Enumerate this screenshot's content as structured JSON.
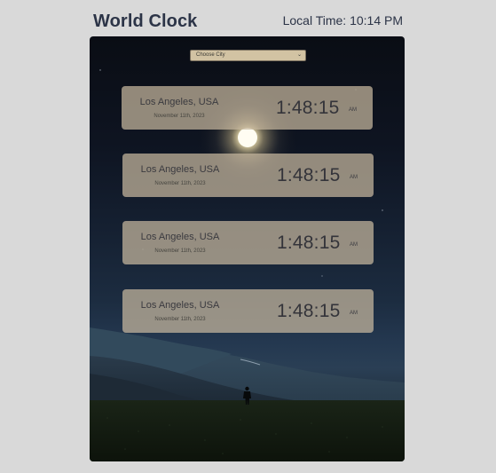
{
  "header": {
    "title": "World Clock",
    "local_time": "Local Time: 10:14 PM"
  },
  "city_select": {
    "selected_label": "Choose City"
  },
  "clocks": [
    {
      "city": "Los Angeles, USA",
      "date": "November 11th, 2023",
      "time": "1:48:15",
      "ampm": "AM"
    },
    {
      "city": "Los Angeles, USA",
      "date": "November 11th, 2023",
      "time": "1:48:15",
      "ampm": "AM"
    },
    {
      "city": "Los Angeles, USA",
      "date": "November 11th, 2023",
      "time": "1:48:15",
      "ampm": "AM"
    },
    {
      "city": "Los Angeles, USA",
      "date": "November 11th, 2023",
      "time": "1:48:15",
      "ampm": "AM"
    }
  ],
  "colors": {
    "page_background": "#d9d9d9",
    "title_text": "#2c3447",
    "card_background": "#c8b9a0",
    "select_background": "#d2c3a3"
  },
  "icons": {
    "select_chevron": "chevron-down-icon"
  }
}
